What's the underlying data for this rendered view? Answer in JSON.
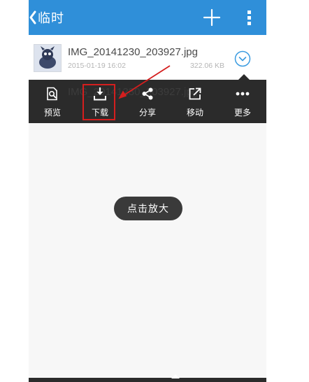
{
  "header": {
    "back_icon": "chevron-left-icon",
    "title": "临时",
    "add_icon": "plus-icon",
    "more_icon": "vertical-ellipsis-icon",
    "bg_color": "#2f8fd9"
  },
  "file": {
    "name": "IMG_20141230_203927.jpg",
    "date": "2015-01-19 16:02",
    "size": "322.06 KB",
    "thumbnail_icon": "image-thumbnail",
    "expand_icon": "chevron-down-circle-icon"
  },
  "action_bar": {
    "ghost_name": "IMG_20141230_203927.jpg",
    "actions": [
      {
        "label": "预览",
        "icon": "preview-icon"
      },
      {
        "label": "下载",
        "icon": "download-icon"
      },
      {
        "label": "分享",
        "icon": "share-icon"
      },
      {
        "label": "移动",
        "icon": "move-icon"
      },
      {
        "label": "更多",
        "icon": "more-dots-icon"
      }
    ],
    "highlight_color": "#d41e1e"
  },
  "toast": {
    "text": "点击放大"
  }
}
